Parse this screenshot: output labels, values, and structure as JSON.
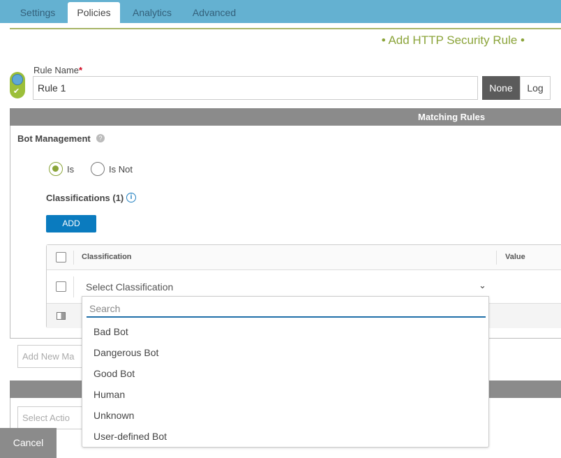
{
  "tabs": [
    {
      "label": "Settings"
    },
    {
      "label": "Policies",
      "active": true
    },
    {
      "label": "Analytics"
    },
    {
      "label": "Advanced"
    }
  ],
  "header": {
    "title": "• Add HTTP Security Rule •"
  },
  "rule": {
    "name_label": "Rule Name",
    "required_mark": "*",
    "name_value": "Rule 1",
    "none_label": "None",
    "log_label": "Log"
  },
  "matching": {
    "title": "Matching Rules",
    "section": "Bot Management",
    "is_label": "Is",
    "is_not_label": "Is Not",
    "selected": "Is",
    "classifications_label": "Classifications (1)",
    "add_label": "ADD",
    "table": {
      "col_classification": "Classification",
      "col_value": "Value",
      "select_placeholder": "Select Classification"
    },
    "add_new_placeholder": "Add New Ma"
  },
  "dropdown": {
    "search_placeholder": "Search",
    "options": [
      "Bad Bot",
      "Dangerous Bot",
      "Good Bot",
      "Human",
      "Unknown",
      "User-defined Bot"
    ]
  },
  "action": {
    "select_placeholder": "Select Actio"
  },
  "footer": {
    "cancel_label": "Cancel"
  },
  "colors": {
    "accent": "#8ba43a",
    "tab_bar": "#64b1d1",
    "primary": "#0a7bbf"
  }
}
